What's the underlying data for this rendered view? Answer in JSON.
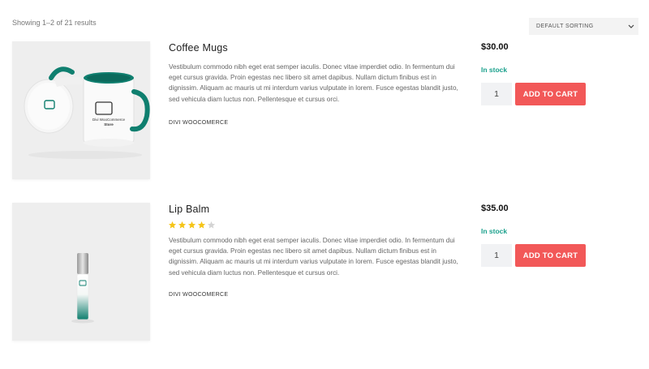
{
  "toolbar": {
    "result_count": "Showing 1–2 of 21 results",
    "sorting_selected": "DEFAULT SORTING"
  },
  "products": [
    {
      "title": "Coffee Mugs",
      "rating": null,
      "description": "Vestibulum commodo nibh eget erat semper iaculis. Donec vitae imperdiet odio. In fermentum dui eget cursus gravida. Proin egestas nec libero sit amet dapibus. Nullam dictum finibus est in dignissim. Aliquam ac mauris ut mi interdum varius vulputate in lorem. Fusce egestas blandit justo, sed vehicula diam luctus non. Pellentesque et cursus orci.",
      "category": "DIVI WOOCOMERCE",
      "price": "$30.00",
      "stock": "In stock",
      "quantity": "1",
      "add_to_cart": "ADD TO CART",
      "mug_label": "Divi WooCommerce Store"
    },
    {
      "title": "Lip Balm",
      "rating": 4,
      "rating_max": 5,
      "description": "Vestibulum commodo nibh eget erat semper iaculis. Donec vitae imperdiet odio. In fermentum dui eget cursus gravida. Proin egestas nec libero sit amet dapibus. Nullam dictum finibus est in dignissim. Aliquam ac mauris ut mi interdum varius vulputate in lorem. Fusce egestas blandit justo, sed vehicula diam luctus non. Pellentesque et cursus orci.",
      "category": "DIVI WOOCOMERCE",
      "price": "$35.00",
      "stock": "In stock",
      "quantity": "1",
      "add_to_cart": "ADD TO CART"
    }
  ],
  "colors": {
    "accent_button": "#f25858",
    "stock_green": "#1aa08c",
    "brand_teal": "#0f7f6f",
    "star_gold": "#f5c518"
  },
  "icons": {
    "sort": "chevron-down-icon",
    "star": "star-icon"
  }
}
